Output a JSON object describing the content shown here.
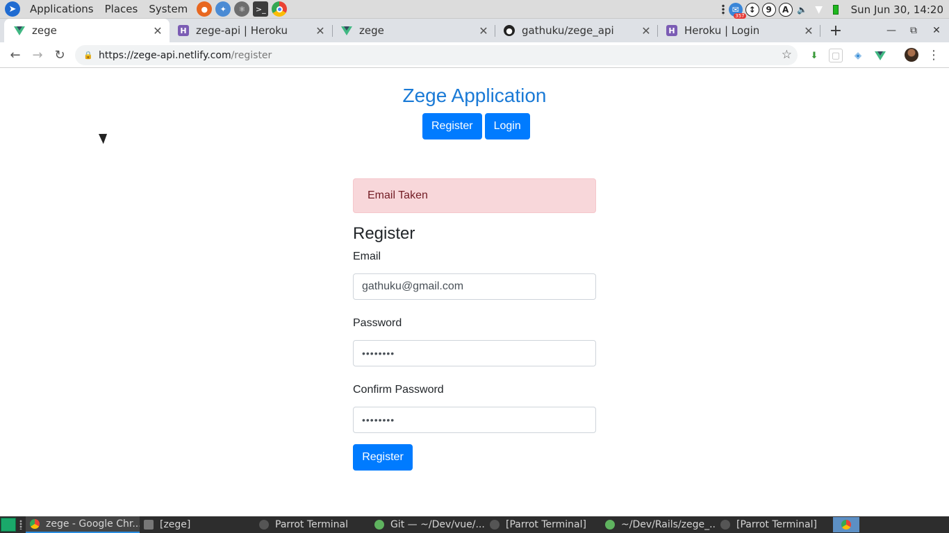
{
  "system_panel": {
    "menus": [
      "Applications",
      "Places",
      "System"
    ],
    "tray_badge": "357",
    "tray_letter_1": "9",
    "tray_letter_2": "A",
    "clock": "Sun Jun 30, 14:20"
  },
  "tabs": [
    {
      "title": "zege",
      "favicon": "vue-icon"
    },
    {
      "title": "zege-api | Heroku",
      "favicon": "heroku-icon"
    },
    {
      "title": "zege",
      "favicon": "vue-icon"
    },
    {
      "title": "gathuku/zege_api",
      "favicon": "github-icon"
    },
    {
      "title": "Heroku | Login",
      "favicon": "heroku-icon"
    }
  ],
  "toolbar": {
    "url_host": "https://zege-api.netlify.com",
    "url_path": "/register"
  },
  "page": {
    "app_title": "Zege Application",
    "nav_register": "Register",
    "nav_login": "Login",
    "alert": "Email Taken",
    "form_title": "Register",
    "email_label": "Email",
    "email_value": "gathuku@gmail.com",
    "password_label": "Password",
    "password_value": "••••••••",
    "confirm_label": "Confirm Password",
    "confirm_value": "••••••••",
    "submit": "Register"
  },
  "taskbar": {
    "items": [
      "zege - Google Chr...",
      "[zege]",
      "Parrot Terminal",
      "Git — ~/Dev/vue/...",
      "[Parrot Terminal]",
      "~/Dev/Rails/zege_...",
      "[Parrot Terminal]"
    ]
  },
  "colors": {
    "primary": "#007bff",
    "title": "#1a7ad6",
    "alert_bg": "#f8d7da",
    "alert_text": "#721c24"
  }
}
